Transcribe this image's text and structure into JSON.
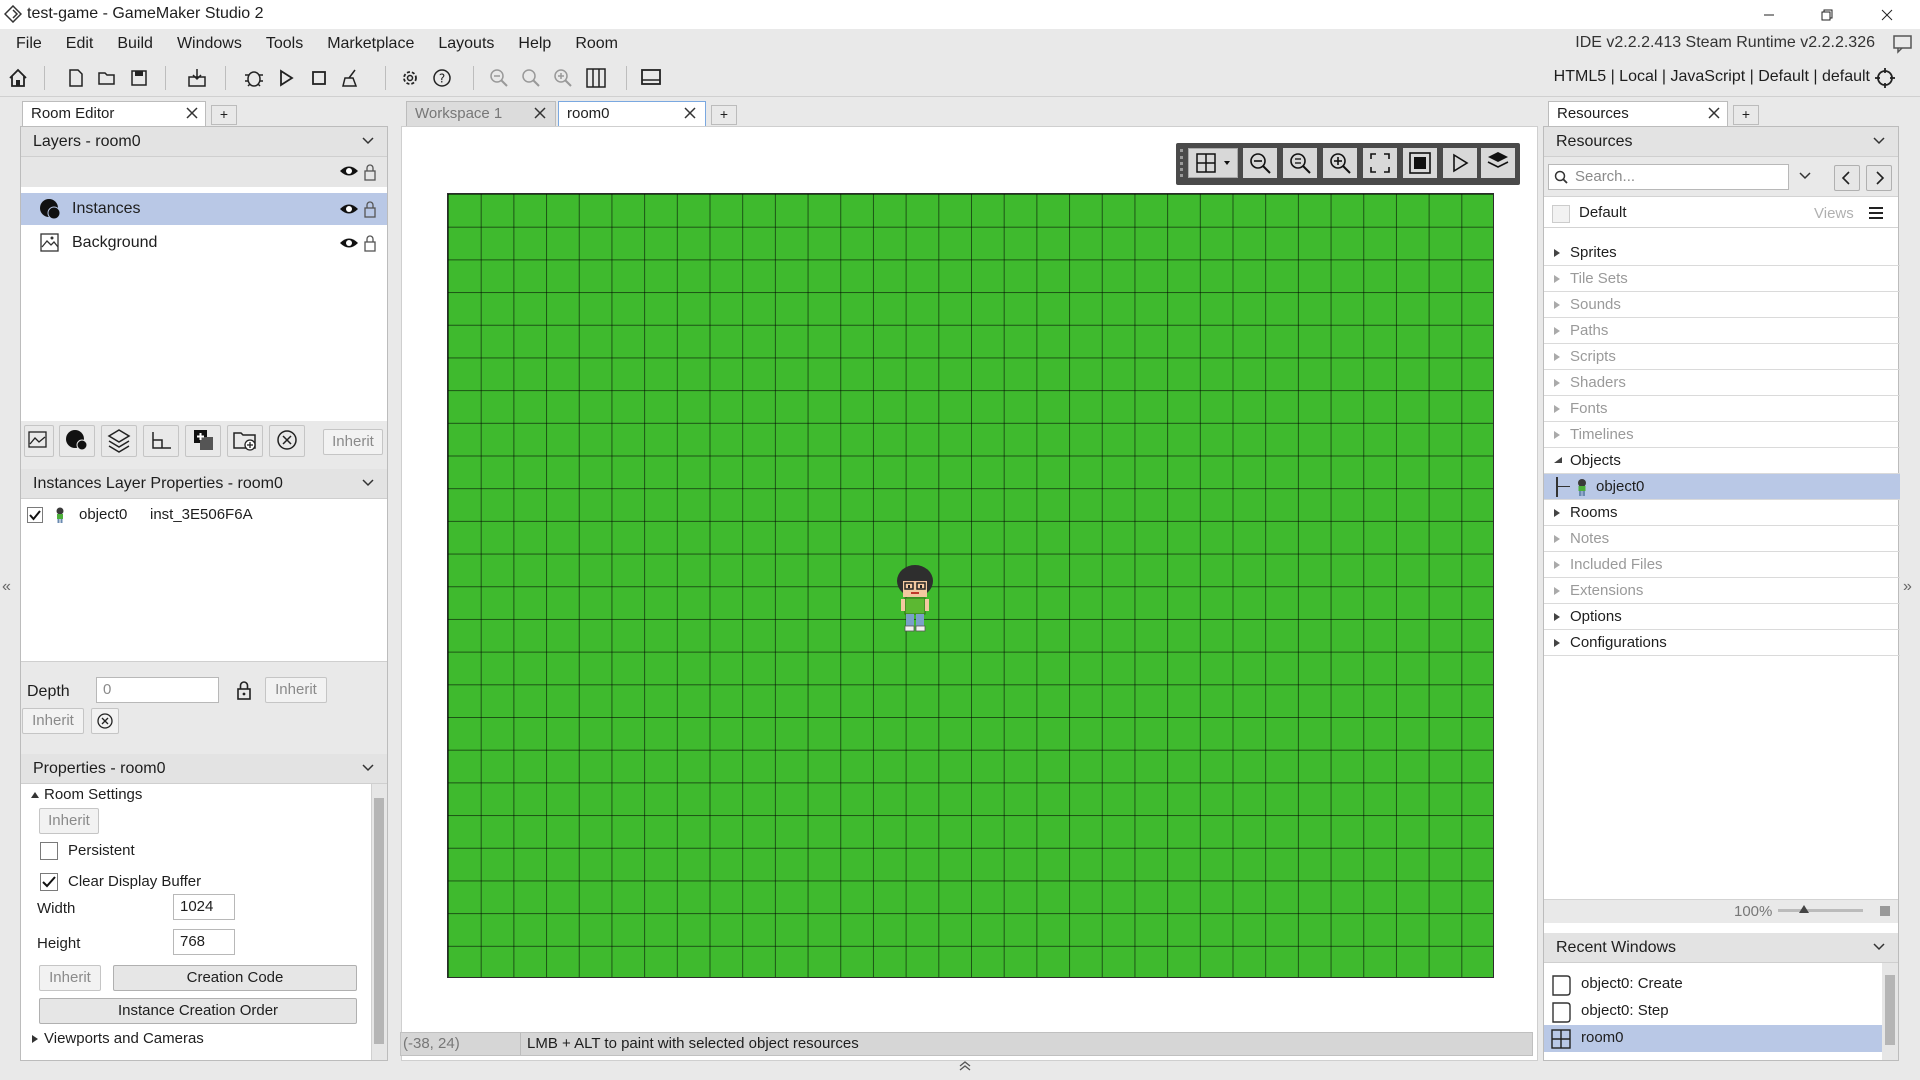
{
  "window": {
    "title": "test-game - GameMaker Studio 2"
  },
  "menu": {
    "items": [
      "File",
      "Edit",
      "Build",
      "Windows",
      "Tools",
      "Marketplace",
      "Layouts",
      "Help",
      "Room"
    ],
    "ide_version": "IDE v2.2.2.413 Steam  Runtime v2.2.2.326"
  },
  "toolbar": {
    "target": "HTML5 | Local | JavaScript | Default | default"
  },
  "left": {
    "tab_label": "Room Editor",
    "layers_header": "Layers - room0",
    "layers": [
      {
        "name": "Instances",
        "selected": true
      },
      {
        "name": "Background",
        "selected": false
      }
    ],
    "inherit_label": "Inherit",
    "instances_header": "Instances Layer Properties - room0",
    "instance": {
      "object": "object0",
      "id": "inst_3E506F6A"
    },
    "depth_label": "Depth",
    "depth_value": "0",
    "properties_header": "Properties - room0",
    "room_settings": "Room Settings",
    "persistent_label": "Persistent",
    "clear_display_label": "Clear Display Buffer",
    "width_label": "Width",
    "width_value": "1024",
    "height_label": "Height",
    "height_value": "768",
    "creation_code": "Creation Code",
    "instance_order": "Instance Creation Order",
    "viewports": "Viewports and Cameras"
  },
  "center": {
    "tabs": [
      {
        "label": "Workspace 1",
        "active": false
      },
      {
        "label": "room0",
        "active": true
      }
    ],
    "coords": "(-38, 24)",
    "status": "LMB + ALT to paint with selected object resources"
  },
  "right": {
    "tab_label": "Resources",
    "header": "Resources",
    "search_placeholder": "Search...",
    "default_label": "Default",
    "views_label": "Views",
    "items": [
      {
        "label": "Sprites",
        "dim": false,
        "expanded": false
      },
      {
        "label": "Tile Sets",
        "dim": true,
        "expanded": false
      },
      {
        "label": "Sounds",
        "dim": true,
        "expanded": false
      },
      {
        "label": "Paths",
        "dim": true,
        "expanded": false
      },
      {
        "label": "Scripts",
        "dim": true,
        "expanded": false
      },
      {
        "label": "Shaders",
        "dim": true,
        "expanded": false
      },
      {
        "label": "Fonts",
        "dim": true,
        "expanded": false
      },
      {
        "label": "Timelines",
        "dim": true,
        "expanded": false
      },
      {
        "label": "Objects",
        "dim": false,
        "expanded": true
      },
      {
        "label": "object0",
        "dim": false,
        "child": true
      },
      {
        "label": "Rooms",
        "dim": false,
        "expanded": false
      },
      {
        "label": "Notes",
        "dim": true,
        "expanded": false
      },
      {
        "label": "Included Files",
        "dim": true,
        "expanded": false
      },
      {
        "label": "Extensions",
        "dim": true,
        "expanded": false
      },
      {
        "label": "Options",
        "dim": false,
        "expanded": false
      },
      {
        "label": "Configurations",
        "dim": false,
        "expanded": false
      }
    ],
    "zoom": "100%",
    "recent_header": "Recent Windows",
    "recent": [
      "object0: Create",
      "object0: Step",
      "room0"
    ]
  },
  "colors": {
    "room_bg": "#3fba2e",
    "selection": "#b9c8e6"
  }
}
